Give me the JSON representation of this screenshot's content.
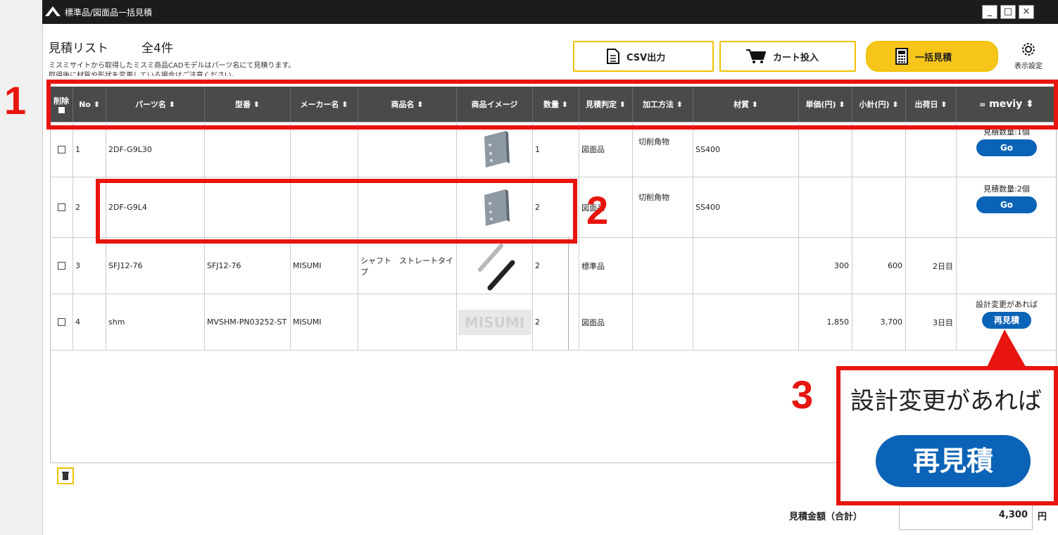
{
  "window": {
    "title": "標準品/図面品一括見積",
    "minimize": "_",
    "maximize": "□",
    "close": "×"
  },
  "header": {
    "list_title": "見積リスト",
    "count": "全4件",
    "note1": "ミスミサイトから取得したミスミ商品CADモデルはパーツ名にて見積ります。",
    "note2": "取得後に材質や形状を変更している場合はご注意ください。"
  },
  "toolbar": {
    "csv": "CSV出力",
    "cart": "カート投入",
    "bulk": "一括見積",
    "settings": "表示設定"
  },
  "columns": {
    "delete": "削除",
    "no": "No",
    "part": "パーツ名",
    "model": "型番",
    "maker": "メーカー名",
    "product": "商品名",
    "image": "商品イメージ",
    "qty": "数量",
    "judge": "見積判定",
    "process": "加工方法",
    "material": "材質",
    "unit": "単価(円)",
    "subtotal": "小計(円)",
    "ship": "出荷日",
    "brand": "meviy"
  },
  "sort_icon": "sort-icon",
  "rows": [
    {
      "no": "1",
      "part": "2DF-G9L30",
      "model": "",
      "maker": "",
      "product": "",
      "qty": "1",
      "judge": "図面品",
      "process": "切削角物",
      "material": "SS400",
      "unit": "",
      "subtotal": "",
      "ship": "",
      "meviy_note": "見積数量:1個",
      "meviy_btn": "Go"
    },
    {
      "no": "2",
      "part": "2DF-G9L4",
      "model": "",
      "maker": "",
      "product": "",
      "qty": "2",
      "judge": "図面品",
      "process": "切削角物",
      "material": "SS400",
      "unit": "",
      "subtotal": "",
      "ship": "",
      "meviy_note": "見積数量:2個",
      "meviy_btn": "Go"
    },
    {
      "no": "3",
      "part": "SFJ12-76",
      "model": "SFJ12-76",
      "maker": "MISUMI",
      "product": "シャフト　ストレートタイプ",
      "qty": "2",
      "judge": "標準品",
      "process": "",
      "material": "",
      "unit": "300",
      "subtotal": "600",
      "ship": "2日目",
      "meviy_note": "",
      "meviy_btn": ""
    },
    {
      "no": "4",
      "part": "shm",
      "model": "MVSHM-PN03252-ST",
      "maker": "MISUMI",
      "product": "",
      "qty": "2",
      "judge": "図面品",
      "process": "",
      "material": "",
      "unit": "1,850",
      "subtotal": "3,700",
      "ship": "3日目",
      "meviy_note": "設計変更があれば",
      "meviy_btn": "再見積",
      "image_text": "MISUMI"
    }
  ],
  "footer": {
    "total_label": "見積金額（合計）",
    "total_value": "4,300",
    "currency": "円"
  },
  "annotations": {
    "n1": "1",
    "n2": "2",
    "n3": "3",
    "zoom_text": "設計変更があれば",
    "zoom_btn": "再見積"
  },
  "colors": {
    "highlight": "#e8140e",
    "accent": "#f8c51b",
    "button_blue": "#0b63b7",
    "header_bg": "#4a4a4a"
  }
}
